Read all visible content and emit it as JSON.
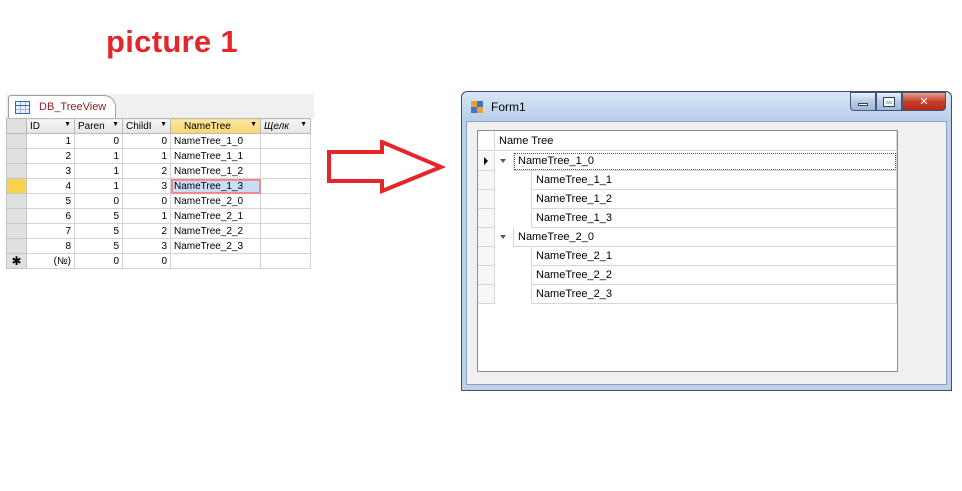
{
  "heading": "picture 1",
  "access": {
    "tab_label": "DB_TreeView",
    "columns": [
      "ID",
      "Paren",
      "ChildI",
      "NameTree",
      "Щелк"
    ],
    "rows": [
      {
        "id": "1",
        "parent": "0",
        "child": "0",
        "name": "NameTree_1_0"
      },
      {
        "id": "2",
        "parent": "1",
        "child": "1",
        "name": "NameTree_1_1"
      },
      {
        "id": "3",
        "parent": "1",
        "child": "2",
        "name": "NameTree_1_2"
      },
      {
        "id": "4",
        "parent": "1",
        "child": "3",
        "name": "NameTree_1_3"
      },
      {
        "id": "5",
        "parent": "0",
        "child": "0",
        "name": "NameTree_2_0"
      },
      {
        "id": "6",
        "parent": "5",
        "child": "1",
        "name": "NameTree_2_1"
      },
      {
        "id": "7",
        "parent": "5",
        "child": "2",
        "name": "NameTree_2_2"
      },
      {
        "id": "8",
        "parent": "5",
        "child": "3",
        "name": "NameTree_2_3"
      }
    ],
    "new_row": {
      "marker": "✱",
      "id": "(№)",
      "parent": "0",
      "child": "0"
    },
    "current_row": 3,
    "selector_color": "#f8d44e",
    "highlight_header_color": "#f8d66b"
  },
  "arrow": {
    "color": "#e3262a"
  },
  "form": {
    "title": "Form1",
    "column_header": "Name Tree",
    "nodes": [
      {
        "label": "NameTree_1_0",
        "level": 0,
        "expanded": true,
        "current": true
      },
      {
        "label": "NameTree_1_1",
        "level": 1
      },
      {
        "label": "NameTree_1_2",
        "level": 1
      },
      {
        "label": "NameTree_1_3",
        "level": 1
      },
      {
        "label": "NameTree_2_0",
        "level": 0,
        "expanded": true
      },
      {
        "label": "NameTree_2_1",
        "level": 1
      },
      {
        "label": "NameTree_2_2",
        "level": 1
      },
      {
        "label": "NameTree_2_3",
        "level": 1
      }
    ]
  }
}
